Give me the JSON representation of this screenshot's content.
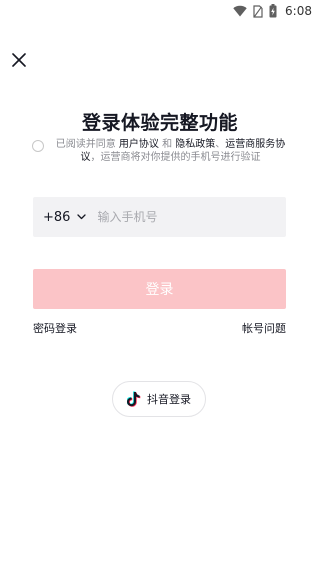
{
  "status_bar": {
    "time": "6:08",
    "icons": [
      "wifi-icon",
      "sim-card-icon",
      "battery-charging-icon"
    ]
  },
  "header": {
    "close_icon": "close-icon"
  },
  "main": {
    "title": "登录体验完整功能",
    "agreement": {
      "prefix": "已阅读并同意",
      "user_agreement": "用户协议",
      "and": "和",
      "privacy_policy": "隐私政策",
      "separator": "、",
      "operator_service": "运营商服务协议",
      "suffix": "，运营商将对你提供的手机号进行验证"
    },
    "phone": {
      "country_code": "+86",
      "placeholder": "输入手机号",
      "value": ""
    },
    "login_label": "登录",
    "password_login": "密码登录",
    "account_issue": "帐号问题",
    "douyin_login": "抖音登录"
  },
  "colors": {
    "login_button_disabled": "#fbc4c7",
    "input_background": "#f2f2f4",
    "text_primary": "#161823",
    "text_secondary": "#8a8b91",
    "douyin_cyan": "#25f4ee",
    "douyin_red": "#fe2c55"
  }
}
